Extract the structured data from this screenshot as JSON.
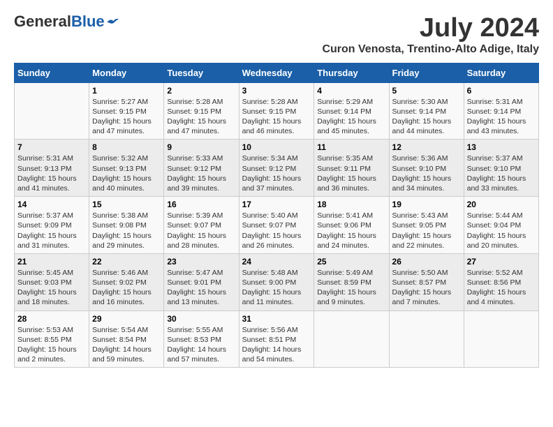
{
  "header": {
    "logo_general": "General",
    "logo_blue": "Blue",
    "month_title": "July 2024",
    "location": "Curon Venosta, Trentino-Alto Adige, Italy"
  },
  "days_of_week": [
    "Sunday",
    "Monday",
    "Tuesday",
    "Wednesday",
    "Thursday",
    "Friday",
    "Saturday"
  ],
  "weeks": [
    [
      {
        "day": "",
        "content": ""
      },
      {
        "day": "1",
        "content": "Sunrise: 5:27 AM\nSunset: 9:15 PM\nDaylight: 15 hours\nand 47 minutes."
      },
      {
        "day": "2",
        "content": "Sunrise: 5:28 AM\nSunset: 9:15 PM\nDaylight: 15 hours\nand 47 minutes."
      },
      {
        "day": "3",
        "content": "Sunrise: 5:28 AM\nSunset: 9:15 PM\nDaylight: 15 hours\nand 46 minutes."
      },
      {
        "day": "4",
        "content": "Sunrise: 5:29 AM\nSunset: 9:14 PM\nDaylight: 15 hours\nand 45 minutes."
      },
      {
        "day": "5",
        "content": "Sunrise: 5:30 AM\nSunset: 9:14 PM\nDaylight: 15 hours\nand 44 minutes."
      },
      {
        "day": "6",
        "content": "Sunrise: 5:31 AM\nSunset: 9:14 PM\nDaylight: 15 hours\nand 43 minutes."
      }
    ],
    [
      {
        "day": "7",
        "content": "Sunrise: 5:31 AM\nSunset: 9:13 PM\nDaylight: 15 hours\nand 41 minutes."
      },
      {
        "day": "8",
        "content": "Sunrise: 5:32 AM\nSunset: 9:13 PM\nDaylight: 15 hours\nand 40 minutes."
      },
      {
        "day": "9",
        "content": "Sunrise: 5:33 AM\nSunset: 9:12 PM\nDaylight: 15 hours\nand 39 minutes."
      },
      {
        "day": "10",
        "content": "Sunrise: 5:34 AM\nSunset: 9:12 PM\nDaylight: 15 hours\nand 37 minutes."
      },
      {
        "day": "11",
        "content": "Sunrise: 5:35 AM\nSunset: 9:11 PM\nDaylight: 15 hours\nand 36 minutes."
      },
      {
        "day": "12",
        "content": "Sunrise: 5:36 AM\nSunset: 9:10 PM\nDaylight: 15 hours\nand 34 minutes."
      },
      {
        "day": "13",
        "content": "Sunrise: 5:37 AM\nSunset: 9:10 PM\nDaylight: 15 hours\nand 33 minutes."
      }
    ],
    [
      {
        "day": "14",
        "content": "Sunrise: 5:37 AM\nSunset: 9:09 PM\nDaylight: 15 hours\nand 31 minutes."
      },
      {
        "day": "15",
        "content": "Sunrise: 5:38 AM\nSunset: 9:08 PM\nDaylight: 15 hours\nand 29 minutes."
      },
      {
        "day": "16",
        "content": "Sunrise: 5:39 AM\nSunset: 9:07 PM\nDaylight: 15 hours\nand 28 minutes."
      },
      {
        "day": "17",
        "content": "Sunrise: 5:40 AM\nSunset: 9:07 PM\nDaylight: 15 hours\nand 26 minutes."
      },
      {
        "day": "18",
        "content": "Sunrise: 5:41 AM\nSunset: 9:06 PM\nDaylight: 15 hours\nand 24 minutes."
      },
      {
        "day": "19",
        "content": "Sunrise: 5:43 AM\nSunset: 9:05 PM\nDaylight: 15 hours\nand 22 minutes."
      },
      {
        "day": "20",
        "content": "Sunrise: 5:44 AM\nSunset: 9:04 PM\nDaylight: 15 hours\nand 20 minutes."
      }
    ],
    [
      {
        "day": "21",
        "content": "Sunrise: 5:45 AM\nSunset: 9:03 PM\nDaylight: 15 hours\nand 18 minutes."
      },
      {
        "day": "22",
        "content": "Sunrise: 5:46 AM\nSunset: 9:02 PM\nDaylight: 15 hours\nand 16 minutes."
      },
      {
        "day": "23",
        "content": "Sunrise: 5:47 AM\nSunset: 9:01 PM\nDaylight: 15 hours\nand 13 minutes."
      },
      {
        "day": "24",
        "content": "Sunrise: 5:48 AM\nSunset: 9:00 PM\nDaylight: 15 hours\nand 11 minutes."
      },
      {
        "day": "25",
        "content": "Sunrise: 5:49 AM\nSunset: 8:59 PM\nDaylight: 15 hours\nand 9 minutes."
      },
      {
        "day": "26",
        "content": "Sunrise: 5:50 AM\nSunset: 8:57 PM\nDaylight: 15 hours\nand 7 minutes."
      },
      {
        "day": "27",
        "content": "Sunrise: 5:52 AM\nSunset: 8:56 PM\nDaylight: 15 hours\nand 4 minutes."
      }
    ],
    [
      {
        "day": "28",
        "content": "Sunrise: 5:53 AM\nSunset: 8:55 PM\nDaylight: 15 hours\nand 2 minutes."
      },
      {
        "day": "29",
        "content": "Sunrise: 5:54 AM\nSunset: 8:54 PM\nDaylight: 14 hours\nand 59 minutes."
      },
      {
        "day": "30",
        "content": "Sunrise: 5:55 AM\nSunset: 8:53 PM\nDaylight: 14 hours\nand 57 minutes."
      },
      {
        "day": "31",
        "content": "Sunrise: 5:56 AM\nSunset: 8:51 PM\nDaylight: 14 hours\nand 54 minutes."
      },
      {
        "day": "",
        "content": ""
      },
      {
        "day": "",
        "content": ""
      },
      {
        "day": "",
        "content": ""
      }
    ]
  ]
}
